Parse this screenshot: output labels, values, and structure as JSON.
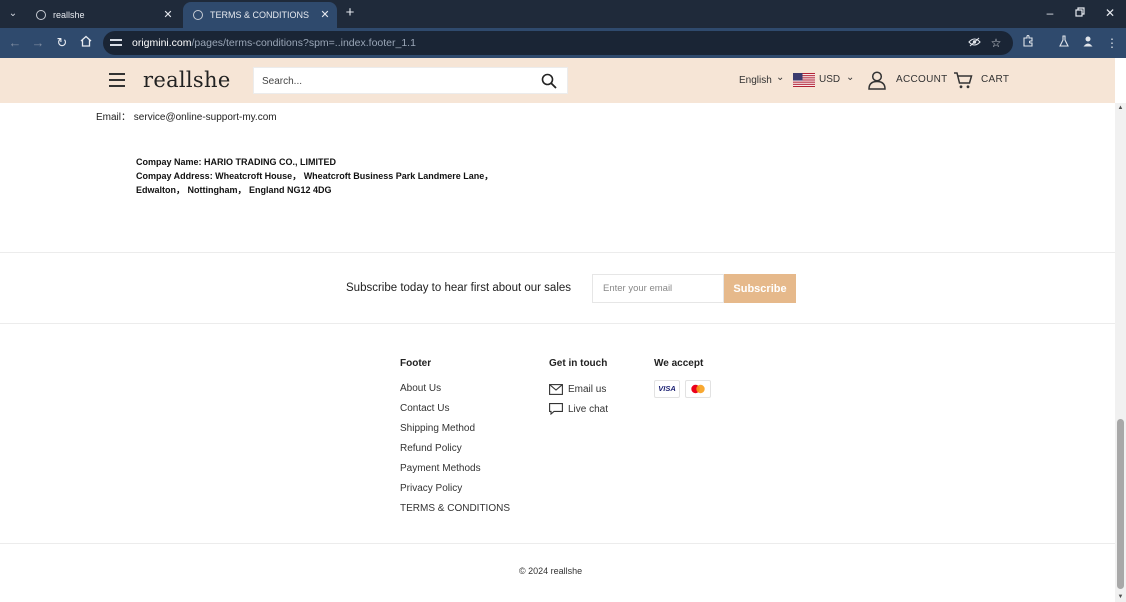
{
  "browser": {
    "tabs": [
      {
        "title": "reallshe",
        "close": "✕"
      },
      {
        "title": "TERMS & CONDITIONS",
        "close": "✕"
      }
    ],
    "new_tab": "+",
    "url_host": "origmini.com",
    "url_path": "/pages/terms-conditions?spm=..index.footer_1.1"
  },
  "header": {
    "logo": "reallshe",
    "search_placeholder": "Search...",
    "language": "English",
    "currency": "USD",
    "account_label": "ACCOUNT",
    "cart_label": "CART"
  },
  "content": {
    "email_label": "Email：",
    "email_value": "service@online-support-my.com",
    "company_name_line": "Compay Name: HARIO TRADING CO., LIMITED",
    "company_address_line1": "Compay Address: Wheatcroft House， Wheatcroft Business Park Landmere Lane，",
    "company_address_line2": "Edwalton， Nottingham， England NG12 4DG"
  },
  "subscribe": {
    "text": "Subscribe today to hear first about our sales",
    "input_placeholder": "Enter your email",
    "button_label": "Subscribe"
  },
  "footer": {
    "col1_title": "Footer",
    "links": [
      "About Us",
      "Contact Us",
      "Shipping Method",
      "Refund Policy",
      "Payment Methods",
      "Privacy Policy",
      "TERMS & CONDITIONS"
    ],
    "col2_title": "Get in touch",
    "touch": [
      "Email us",
      "Live chat"
    ],
    "col3_title": "We accept",
    "payment_icons": [
      "visa-icon",
      "mastercard-icon"
    ],
    "visa_text": "VISA",
    "copyright": "© 2024 reallshe"
  },
  "colors": {
    "header_bg": "#f6e5d6",
    "subscribe_button": "#e6b98b",
    "browser_frame": "#1f2a3a",
    "browser_toolbar": "#2f4a6d"
  }
}
